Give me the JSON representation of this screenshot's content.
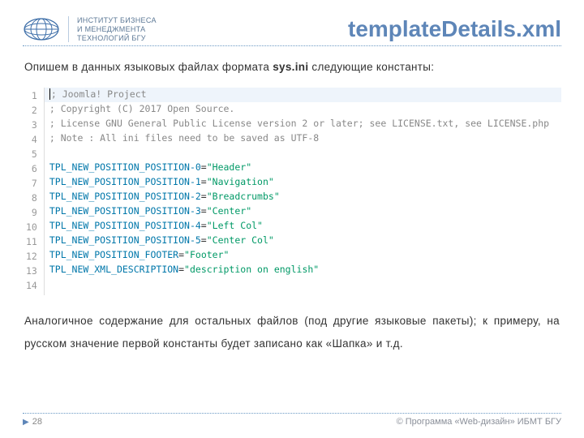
{
  "header": {
    "org_line1": "ИНСТИТУТ БИЗНЕСА",
    "org_line2": "И МЕНЕДЖМЕНТА",
    "org_line3": "ТЕХНОЛОГИЙ БГУ",
    "title": "templateDetails.xml"
  },
  "intro_pre": "Опишем в данных языковых файлах формата ",
  "intro_bold": "sys.ini",
  "intro_post": " следующие константы:",
  "code": {
    "lines": [
      {
        "n": 1,
        "hl": true,
        "tokens": [
          {
            "cls": "cursor",
            "txt": ""
          },
          {
            "cls": "tok-comment",
            "txt": "; Joomla! Project"
          }
        ]
      },
      {
        "n": 2,
        "hl": false,
        "tokens": [
          {
            "cls": "tok-comment",
            "txt": "; Copyright (C) 2017 Open Source."
          }
        ]
      },
      {
        "n": 3,
        "hl": false,
        "tokens": [
          {
            "cls": "tok-comment",
            "txt": "; License GNU General Public License version 2 or later; see LICENSE.txt, see LICENSE.php"
          }
        ]
      },
      {
        "n": 4,
        "hl": false,
        "tokens": [
          {
            "cls": "tok-comment",
            "txt": "; Note : All ini files need to be saved as UTF-8"
          }
        ]
      },
      {
        "n": 5,
        "hl": false,
        "tokens": [
          {
            "cls": "",
            "txt": ""
          }
        ]
      },
      {
        "n": 6,
        "hl": false,
        "tokens": [
          {
            "cls": "tok-key",
            "txt": "TPL_NEW_POSITION_POSITION-0"
          },
          {
            "cls": "",
            "txt": "="
          },
          {
            "cls": "tok-str",
            "txt": "\"Header\""
          }
        ]
      },
      {
        "n": 7,
        "hl": false,
        "tokens": [
          {
            "cls": "tok-key",
            "txt": "TPL_NEW_POSITION_POSITION-1"
          },
          {
            "cls": "",
            "txt": "="
          },
          {
            "cls": "tok-str",
            "txt": "\"Navigation\""
          }
        ]
      },
      {
        "n": 8,
        "hl": false,
        "tokens": [
          {
            "cls": "tok-key",
            "txt": "TPL_NEW_POSITION_POSITION-2"
          },
          {
            "cls": "",
            "txt": "="
          },
          {
            "cls": "tok-str",
            "txt": "\"Breadcrumbs\""
          }
        ]
      },
      {
        "n": 9,
        "hl": false,
        "tokens": [
          {
            "cls": "tok-key",
            "txt": "TPL_NEW_POSITION_POSITION-3"
          },
          {
            "cls": "",
            "txt": "="
          },
          {
            "cls": "tok-str",
            "txt": "\"Center\""
          }
        ]
      },
      {
        "n": 10,
        "hl": false,
        "tokens": [
          {
            "cls": "tok-key",
            "txt": "TPL_NEW_POSITION_POSITION-4"
          },
          {
            "cls": "",
            "txt": "="
          },
          {
            "cls": "tok-str",
            "txt": "\"Left Col\""
          }
        ]
      },
      {
        "n": 11,
        "hl": false,
        "tokens": [
          {
            "cls": "tok-key",
            "txt": "TPL_NEW_POSITION_POSITION-5"
          },
          {
            "cls": "",
            "txt": "="
          },
          {
            "cls": "tok-str",
            "txt": "\"Center Col\""
          }
        ]
      },
      {
        "n": 12,
        "hl": false,
        "tokens": [
          {
            "cls": "tok-key",
            "txt": "TPL_NEW_POSITION_FOOTER"
          },
          {
            "cls": "",
            "txt": "="
          },
          {
            "cls": "tok-str",
            "txt": "\"Footer\""
          }
        ]
      },
      {
        "n": 13,
        "hl": false,
        "tokens": [
          {
            "cls": "tok-key",
            "txt": "TPL_NEW_XML_DESCRIPTION"
          },
          {
            "cls": "",
            "txt": "="
          },
          {
            "cls": "tok-str",
            "txt": "\"description on english\""
          }
        ]
      },
      {
        "n": 14,
        "hl": false,
        "tokens": [
          {
            "cls": "",
            "txt": ""
          }
        ]
      }
    ]
  },
  "outro": "Аналогичное содержание для остальных файлов (под другие языковые пакеты); к примеру, на русском значение первой константы будет записано как «Шапка» и т.д.",
  "footer": {
    "page": "28",
    "copyright": "© Программа «Web-дизайн» ИБМТ БГУ"
  }
}
